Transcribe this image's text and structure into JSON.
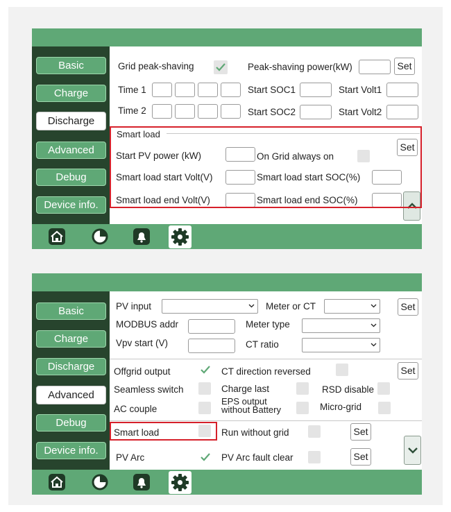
{
  "nav": {
    "basic": "Basic",
    "charge": "Charge",
    "discharge": "Discharge",
    "advanced": "Advanced",
    "debug": "Debug",
    "device_info": "Device info."
  },
  "bottom_icons": [
    "home-icon",
    "pie-chart-icon",
    "bell-icon",
    "gear-icon"
  ],
  "colors": {
    "accent": "#5fa876",
    "sidebar": "#27442d",
    "highlight": "#d6202a"
  },
  "panel1": {
    "active_tab": "Discharge",
    "grid_peak_shaving": "Grid peak-shaving",
    "grid_peak_shaving_checked": true,
    "peak_shaving_power": "Peak-shaving power(kW)",
    "set": "Set",
    "time1": "Time 1",
    "time2": "Time 2",
    "start_soc1": "Start SOC1",
    "start_volt1": "Start Volt1",
    "start_soc2": "Start SOC2",
    "start_volt2": "Start Volt2",
    "smart_load_group": "Smart load",
    "start_pv_power": "Start PV power (kW)",
    "on_grid_always_on": "On Grid always on",
    "smart_load_start_volt": "Smart load start Volt(V)",
    "smart_load_start_soc": "Smart load start SOC(%)",
    "smart_load_end_volt": "Smart load end Volt(V)",
    "smart_load_end_soc": "Smart load end SOC(%)"
  },
  "panel2": {
    "active_tab": "Advanced",
    "pv_input": "PV input",
    "meter_or_ct": "Meter or CT",
    "modbus_addr": "MODBUS addr",
    "meter_type": "Meter type",
    "vpv_start": "Vpv start (V)",
    "ct_ratio": "CT ratio",
    "set": "Set",
    "offgrid_output": "Offgrid output",
    "offgrid_output_checked": true,
    "ct_direction_reversed": "CT direction reversed",
    "seamless_switch": "Seamless switch",
    "charge_last": "Charge last",
    "rsd_disable": "RSD disable",
    "ac_couple": "AC couple",
    "eps_output_line1": "EPS output",
    "eps_output_line2": "without Battery",
    "micro_grid": "Micro-grid",
    "smart_load": "Smart load",
    "run_without_grid": "Run without grid",
    "pv_arc": "PV Arc",
    "pv_arc_checked": true,
    "pv_arc_fault_clear": "PV Arc fault clear"
  }
}
